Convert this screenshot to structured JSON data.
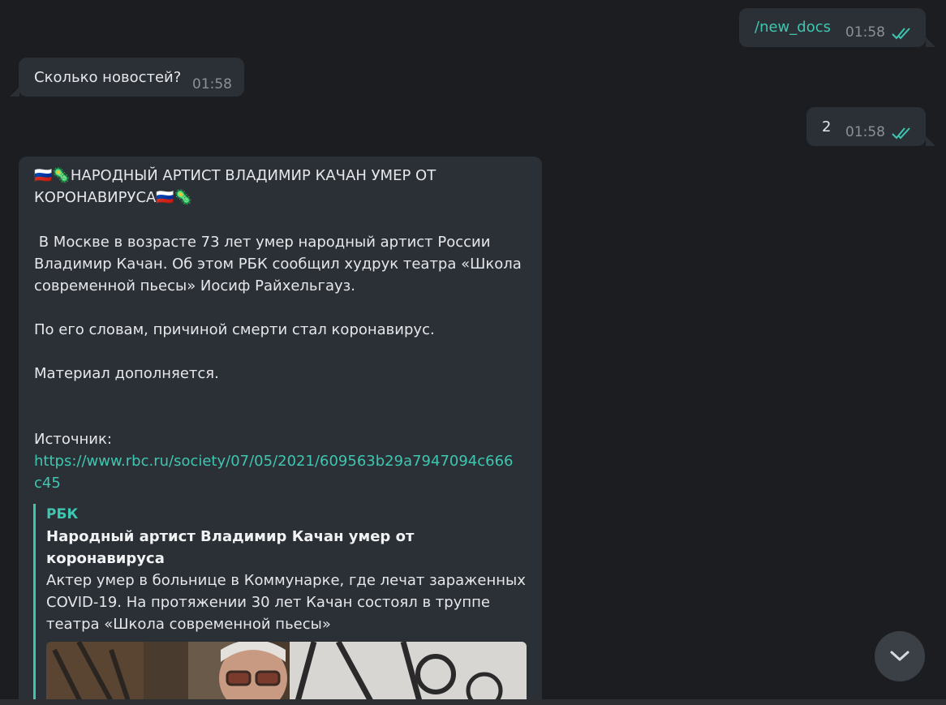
{
  "messages": {
    "m1": {
      "text": "/new_docs",
      "time": "01:58",
      "icon": "double-check-icon"
    },
    "m2": {
      "text": "Сколько новостей?",
      "time": "01:58"
    },
    "m3": {
      "text": "2",
      "time": "01:58",
      "icon": "double-check-icon"
    },
    "news": {
      "headline_line1": "НАРОДНЫЙ АРТИСТ ВЛАДИМИР КАЧАН УМЕР ОТ",
      "headline_line2": "КОРОНАВИРУСА",
      "flag_emoji": "🇷🇺",
      "virus_emoji": "🦠",
      "body": " В Москве в возрасте 73 лет умер народный артист России\nВладимир Качан. Об этом РБК сообщил худрук театра «Школа\nсовременной пьесы» Иосиф Райхельгауз.\n\nПо его словам, причиной смерти стал коронавирус.\n\nМатериал дополняется.",
      "source_label": "Источник:",
      "link": "https://www.rbc.ru/society/07/05/2021/609563b29a7947094c666c45",
      "preview": {
        "site": "РБК",
        "title": "Народный артист Владимир Качан умер от коронавируса",
        "description": "Актер умер в больнице в Коммунарке, где лечат зараженных COVID-19. На протяжении 30 лет Качан состоял в труппе театра «Школа современной пьесы»"
      }
    }
  },
  "scroll_button": {
    "icon": "chevron-down-icon"
  },
  "colors": {
    "background": "#1c1d20",
    "bubble": "#2b3036",
    "accent": "#3fc6b0",
    "meta": "#8a9097"
  }
}
